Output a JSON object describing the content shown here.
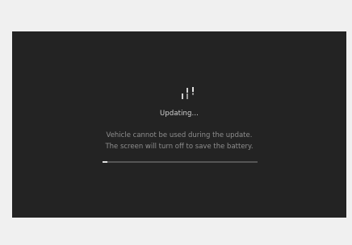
{
  "update": {
    "title": "Updating...",
    "message_line1": "Vehicle cannot be used during the update.",
    "message_line2": "The screen will turn off to save the battery.",
    "progress": 0.03
  },
  "icons": {
    "spinner": "loading-spinner-icon"
  },
  "colors": {
    "screen_background": "#232323",
    "title_text": "#d4d4d4",
    "message_text": "#8e8e8e",
    "progress_fill": "#e0e0e0",
    "progress_track": "#555555"
  }
}
